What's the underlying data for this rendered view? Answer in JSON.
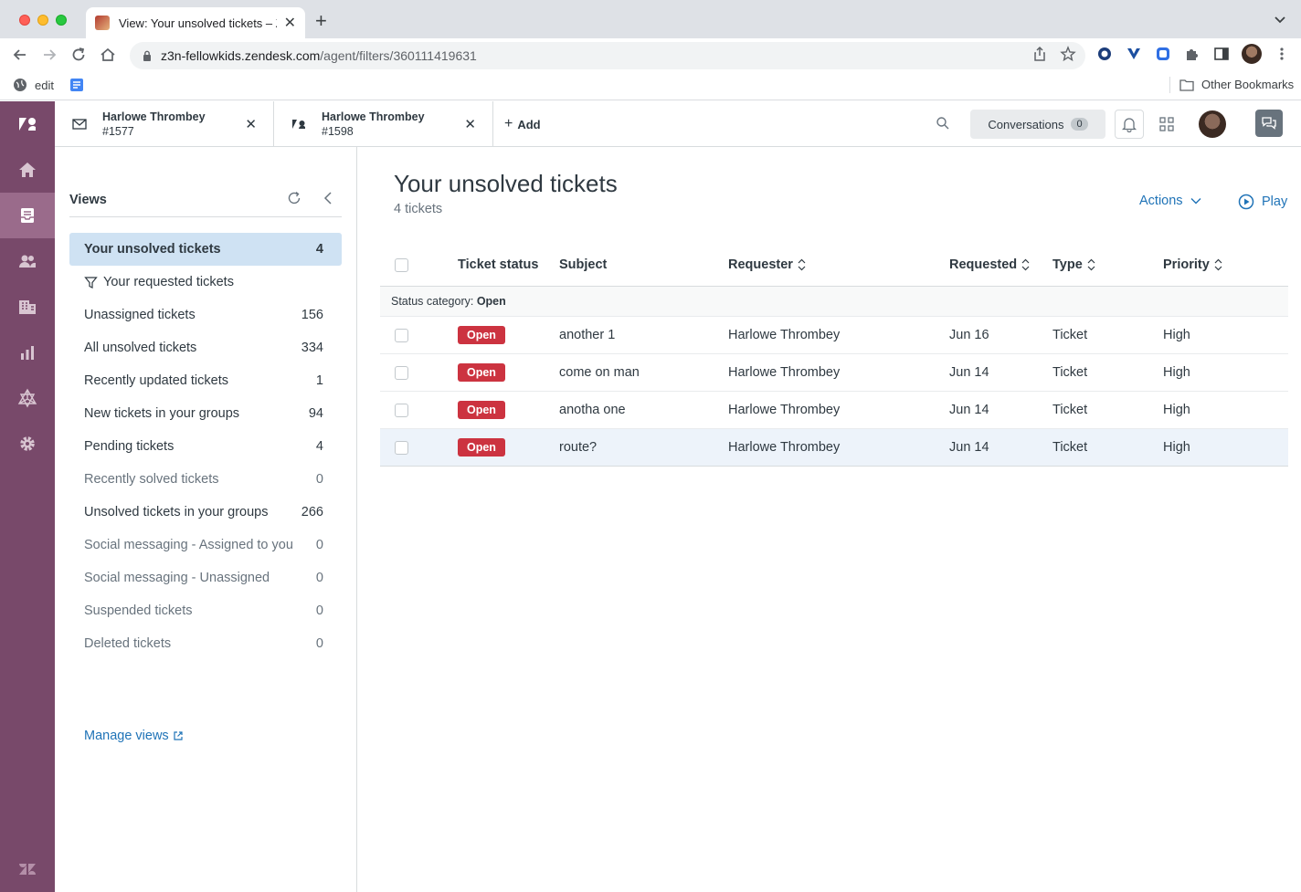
{
  "browser": {
    "tab_title": "View: Your unsolved tickets – Z",
    "url_host": "z3n-fellowkids.zendesk.com",
    "url_path": "/agent/filters/360111419631",
    "bookmarks": [
      {
        "label": "edit",
        "icon": "globe-icon"
      },
      {
        "label": "",
        "icon": "docs-icon"
      }
    ],
    "other_bookmarks": "Other Bookmarks"
  },
  "rail": {
    "items": [
      "zendesk-logo",
      "home-icon",
      "views-icon",
      "customers-icon",
      "organizations-icon",
      "reporting-icon",
      "sell-icon",
      "admin-gear-icon",
      "zendesk-z-logo"
    ],
    "active": "views-icon",
    "color": "#78496a"
  },
  "header": {
    "tabs": [
      {
        "name": "Harlowe Thrombey",
        "id": "#1577",
        "icon": "mail-icon"
      },
      {
        "name": "Harlowe Thrombey",
        "id": "#1598",
        "icon": "zendesk-icon"
      }
    ],
    "add_label": "Add",
    "conversations_label": "Conversations",
    "conversations_count": "0"
  },
  "views": {
    "title": "Views",
    "items": [
      {
        "label": "Your unsolved tickets",
        "count": "4",
        "selected": true
      },
      {
        "label": "Your requested tickets",
        "count": "",
        "filter": true
      },
      {
        "label": "Unassigned tickets",
        "count": "156"
      },
      {
        "label": "All unsolved tickets",
        "count": "334"
      },
      {
        "label": "Recently updated tickets",
        "count": "1"
      },
      {
        "label": "New tickets in your groups",
        "count": "94"
      },
      {
        "label": "Pending tickets",
        "count": "4"
      },
      {
        "label": "Recently solved tickets",
        "count": "0",
        "muted": true
      },
      {
        "label": "Unsolved tickets in your groups",
        "count": "266"
      },
      {
        "label": "Social messaging - Assigned to you",
        "count": "0",
        "muted": true
      },
      {
        "label": "Social messaging - Unassigned",
        "count": "0",
        "muted": true
      },
      {
        "label": "Suspended tickets",
        "count": "0",
        "muted": true
      },
      {
        "label": "Deleted tickets",
        "count": "0",
        "muted": true
      }
    ],
    "manage_label": "Manage views"
  },
  "main": {
    "title": "Your unsolved tickets",
    "subtitle": "4 tickets",
    "actions_label": "Actions",
    "play_label": "Play",
    "columns": [
      "Ticket status",
      "Subject",
      "Requester",
      "Requested",
      "Type",
      "Priority"
    ],
    "group_label": "Status category:",
    "group_value": "Open",
    "rows": [
      {
        "status": "Open",
        "subject": "another 1",
        "requester": "Harlowe Thrombey",
        "requested": "Jun 16",
        "type": "Ticket",
        "priority": "High"
      },
      {
        "status": "Open",
        "subject": "come on man",
        "requester": "Harlowe Thrombey",
        "requested": "Jun 14",
        "type": "Ticket",
        "priority": "High"
      },
      {
        "status": "Open",
        "subject": "anotha one",
        "requester": "Harlowe Thrombey",
        "requested": "Jun 14",
        "type": "Ticket",
        "priority": "High"
      },
      {
        "status": "Open",
        "subject": "route?",
        "requester": "Harlowe Thrombey",
        "requested": "Jun 14",
        "type": "Ticket",
        "priority": "High",
        "highlighted": true
      }
    ],
    "status_color": "#cc3340",
    "link_color": "#1f73b7"
  }
}
